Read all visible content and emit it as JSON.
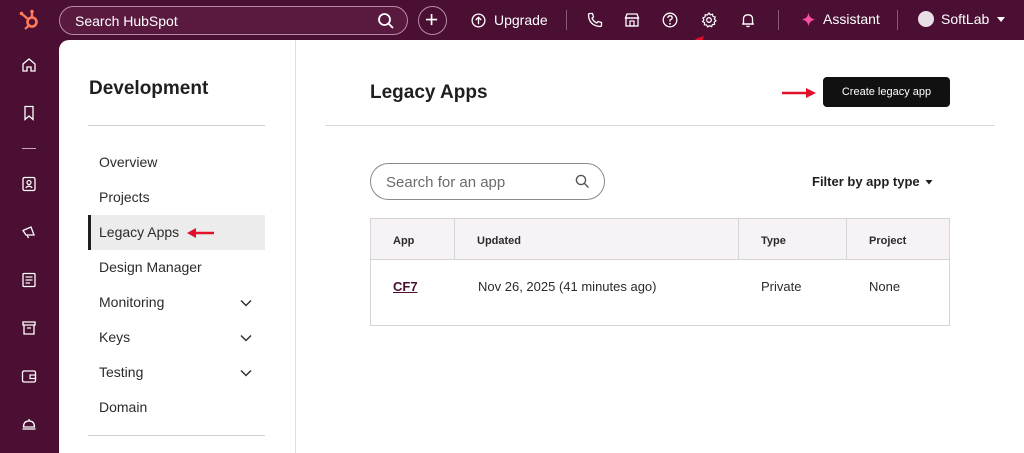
{
  "topbar": {
    "search_placeholder": "Search HubSpot",
    "upgrade_label": "Upgrade",
    "assistant_label": "Assistant",
    "account_name": "SoftLab"
  },
  "sidenav": {
    "title": "Development",
    "items": [
      {
        "label": "Overview"
      },
      {
        "label": "Projects"
      },
      {
        "label": "Legacy Apps"
      },
      {
        "label": "Design Manager"
      },
      {
        "label": "Monitoring"
      },
      {
        "label": "Keys"
      },
      {
        "label": "Testing"
      },
      {
        "label": "Domain"
      }
    ]
  },
  "main": {
    "title": "Legacy Apps",
    "create_button": "Create legacy app",
    "search_placeholder": "Search for an app",
    "filter_label": "Filter by app type",
    "table": {
      "headers": [
        "App",
        "Updated",
        "Type",
        "Project"
      ],
      "rows": [
        {
          "app": "CF7",
          "updated": "Nov 26, 2025 (41 minutes ago)",
          "type": "Private",
          "project": "None"
        }
      ]
    }
  },
  "colors": {
    "brand": "#4a0f32",
    "annotation_arrow": "#e0102a",
    "assistant_spark": "#ff4fa3"
  }
}
